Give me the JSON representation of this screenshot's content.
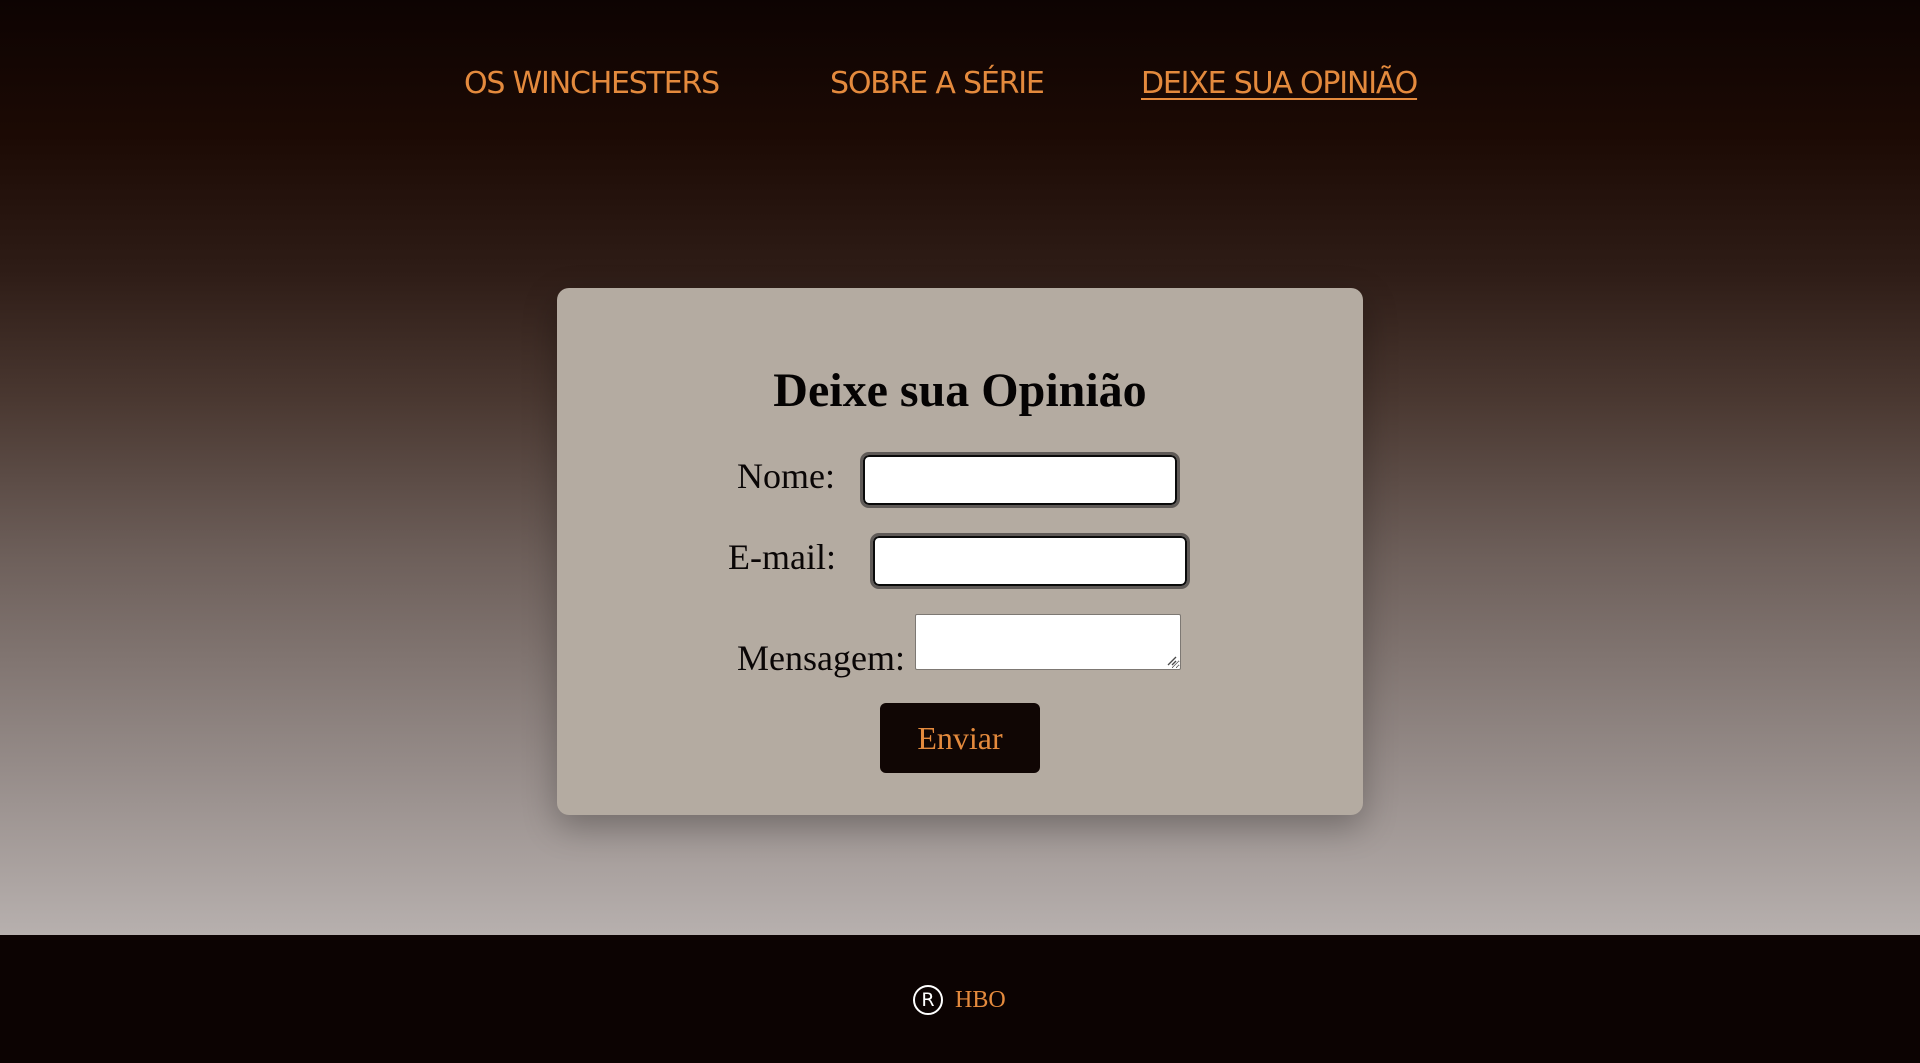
{
  "nav": {
    "items": [
      {
        "label": "OS WINCHESTERS",
        "active": false
      },
      {
        "label": "SOBRE A SÉRIE",
        "active": false
      },
      {
        "label": "DEIXE SUA OPINIÃO",
        "active": true
      }
    ]
  },
  "form": {
    "title": "Deixe sua Opinião",
    "fields": {
      "name": {
        "label": "Nome:",
        "value": ""
      },
      "email": {
        "label": "E-mail:",
        "value": ""
      },
      "message": {
        "label": "Mensagem:",
        "value": ""
      }
    },
    "submit_label": "Enviar"
  },
  "footer": {
    "icon": "registered-icon",
    "symbol": "R",
    "brand": "HBO"
  },
  "colors": {
    "accent": "#e48a3d",
    "card": "#b4aba1",
    "dark": "#0c0302"
  }
}
